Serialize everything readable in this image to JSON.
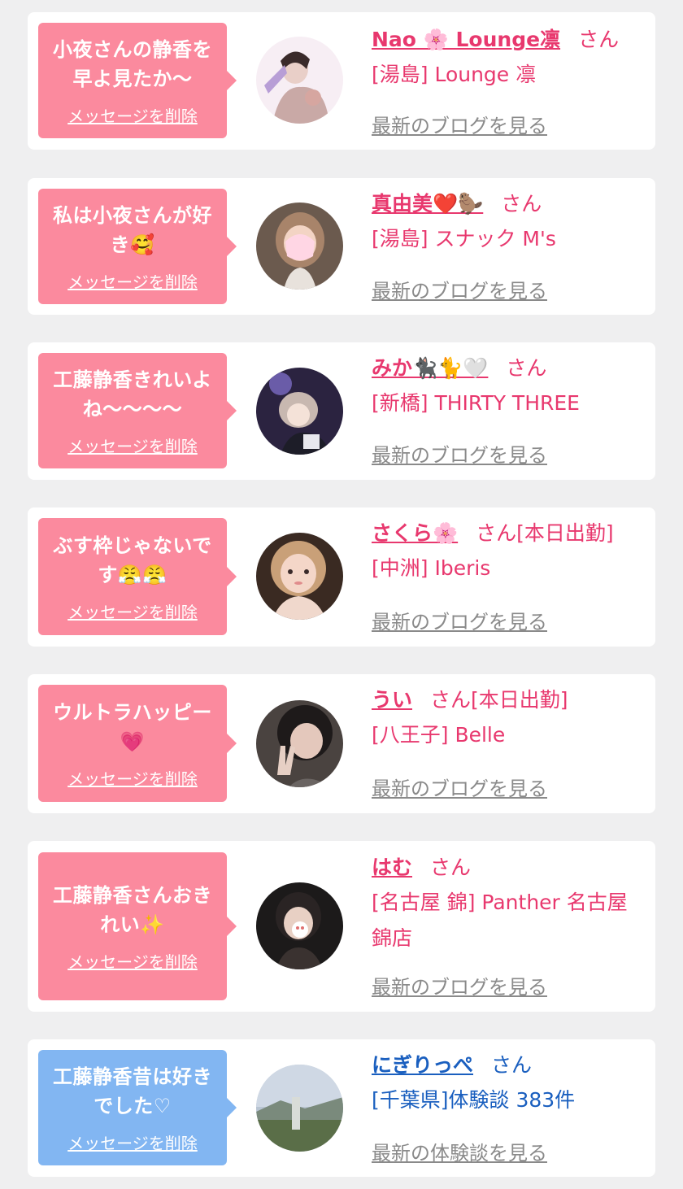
{
  "items": [
    {
      "message": "小夜さんの静香を早よ見たか〜",
      "delete_label": "メッセージを削除",
      "name": "Nao 🌸 Lounge凛",
      "honorific": "さん",
      "status": "",
      "shop": "[湯島] Lounge 凛",
      "link": "最新のブログを見る",
      "theme": "pink"
    },
    {
      "message": "私は小夜さんが好き🥰",
      "delete_label": "メッセージを削除",
      "name": "真由美❤️🦫",
      "honorific": "さん",
      "status": "",
      "shop": "[湯島] スナック M's",
      "link": "最新のブログを見る",
      "theme": "pink"
    },
    {
      "message": "工藤静香きれいよね〜〜〜〜",
      "delete_label": "メッセージを削除",
      "name": "みか🐈‍⬛🐈🤍",
      "honorific": "さん",
      "status": "",
      "shop": "[新橋] THIRTY THREE",
      "link": "最新のブログを見る",
      "theme": "pink"
    },
    {
      "message": "ぶす枠じゃないです😤😤",
      "delete_label": "メッセージを削除",
      "name": "さくら🌸",
      "honorific": "さん",
      "status": "[本日出勤]",
      "shop": "[中洲] Iberis",
      "link": "最新のブログを見る",
      "theme": "pink"
    },
    {
      "message": "ウルトラハッピー💗",
      "delete_label": "メッセージを削除",
      "name": "うい",
      "honorific": "さん",
      "status": "[本日出勤]",
      "shop": "[八王子] Belle",
      "link": "最新のブログを見る",
      "theme": "pink"
    },
    {
      "message": "工藤静香さんおきれい✨",
      "delete_label": "メッセージを削除",
      "name": "はむ",
      "honorific": "さん",
      "status": "",
      "shop": "[名古屋 錦] Panther 名古屋錦店",
      "link": "最新のブログを見る",
      "theme": "pink"
    },
    {
      "message": "工藤静香昔は好きでした♡",
      "delete_label": "メッセージを削除",
      "name": "にぎりっぺ",
      "honorific": "さん",
      "status": "",
      "shop": "[千葉県]体験談 383件",
      "link": "最新の体験談を見る",
      "theme": "blue"
    }
  ]
}
